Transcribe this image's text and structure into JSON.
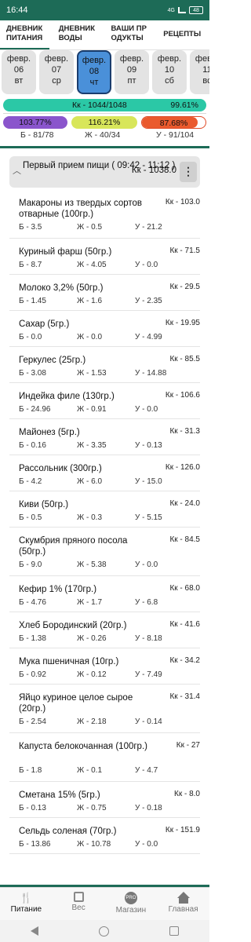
{
  "status": {
    "time": "16:44",
    "network": "4G",
    "battery": "48"
  },
  "tabs": [
    {
      "label": "ДНЕВНИК ПИТАНИЯ"
    },
    {
      "label": "ДНЕВНИК ВОДЫ"
    },
    {
      "label": "ВАШИ ПР ОДУКТЫ"
    },
    {
      "label": "РЕЦЕПТЫ"
    }
  ],
  "days": [
    {
      "month": "февр.",
      "day": "06",
      "dow": "вт"
    },
    {
      "month": "февр.",
      "day": "07",
      "dow": "ср"
    },
    {
      "month": "февр.",
      "day": "08",
      "dow": "чт"
    },
    {
      "month": "февр.",
      "day": "09",
      "dow": "пт"
    },
    {
      "month": "февр.",
      "day": "10",
      "dow": "сб"
    },
    {
      "month": "февр.",
      "day": "11",
      "dow": "вс"
    }
  ],
  "summary": {
    "kcal": "Кк - 1044/1048",
    "kcal_pct": "99.61%",
    "protein_pct": "103.77%",
    "fat_pct": "116.21%",
    "carbs_pct": "87.68%",
    "carbs_fill": 0.8768,
    "protein": "Б - 81/78",
    "fat": "Ж - 40/34",
    "carbs": "У - 91/104"
  },
  "meal": {
    "title": "Первый прием пищи ( 09:42 - 11:12 )",
    "kcal": "Кк - 1038.0",
    "more": "⋮",
    "chevron": "︿"
  },
  "items": [
    {
      "name": "Макароны из твердых сортов отварные (100гр.)",
      "kk": "Кк - 103.0",
      "b": "Б - 3.5",
      "j": "Ж - 0.5",
      "u": "У - 21.2"
    },
    {
      "name": "Куриный фарш (50гр.)",
      "kk": "Кк - 71.5",
      "b": "Б - 8.7",
      "j": "Ж - 4.05",
      "u": "У - 0.0"
    },
    {
      "name": "Молоко 3,2% (50гр.)",
      "kk": "Кк - 29.5",
      "b": "Б - 1.45",
      "j": "Ж - 1.6",
      "u": "У - 2.35"
    },
    {
      "name": "Сахар (5гр.)",
      "kk": "Кк - 19.95",
      "b": "Б - 0.0",
      "j": "Ж - 0.0",
      "u": "У - 4.99"
    },
    {
      "name": "Геркулес (25гр.)",
      "kk": "Кк - 85.5",
      "b": "Б - 3.08",
      "j": "Ж - 1.53",
      "u": "У - 14.88"
    },
    {
      "name": "Индейка филе (130гр.)",
      "kk": "Кк - 106.6",
      "b": "Б - 24.96",
      "j": "Ж - 0.91",
      "u": "У - 0.0"
    },
    {
      "name": "Майонез (5гр.)",
      "kk": "Кк - 31.3",
      "b": "Б - 0.16",
      "j": "Ж - 3.35",
      "u": "У - 0.13"
    },
    {
      "name": "Рассольник (300гр.)",
      "kk": "Кк - 126.0",
      "b": "Б - 4.2",
      "j": "Ж - 6.0",
      "u": "У - 15.0"
    },
    {
      "name": "Киви (50гр.)",
      "kk": "Кк - 24.0",
      "b": "Б - 0.5",
      "j": "Ж - 0.3",
      "u": "У - 5.15"
    },
    {
      "name": "Скумбрия пряного посола (50гр.)",
      "kk": "Кк - 84.5",
      "b": "Б - 9.0",
      "j": "Ж - 5.38",
      "u": "У - 0.0"
    },
    {
      "name": "Кефир 1% (170гр.)",
      "kk": "Кк - 68.0",
      "b": "Б - 4.76",
      "j": "Ж - 1.7",
      "u": "У - 6.8"
    },
    {
      "name": "Хлеб Бородинский (20гр.)",
      "kk": "Кк - 41.6",
      "b": "Б - 1.38",
      "j": "Ж - 0.26",
      "u": "У - 8.18"
    },
    {
      "name": "Мука пшеничная (10гр.)",
      "kk": "Кк - 34.2",
      "b": "Б - 0.92",
      "j": "Ж - 0.12",
      "u": "У - 7.49"
    },
    {
      "name": "Яйцо куриное целое сырое (20гр.)",
      "kk": "Кк - 31.4",
      "b": "Б - 2.54",
      "j": "Ж - 2.18",
      "u": "У - 0.14"
    },
    {
      "name": "Капуста белокочанная (100гр.)",
      "kk": "Кк - 27",
      "b": "Б - 1.8",
      "j": "Ж - 0.1",
      "u": "У - 4.7"
    },
    {
      "name": "Сметана 15% (5гр.)",
      "kk": "Кк - 8.0",
      "b": "Б - 0.13",
      "j": "Ж - 0.75",
      "u": "У - 0.18"
    },
    {
      "name": "Сельдь соленая (70гр.)",
      "kk": "Кк - 151.9",
      "b": "Б - 13.86",
      "j": "Ж - 10.78",
      "u": "У - 0.0"
    }
  ],
  "bottom_nav": [
    {
      "label": "Питание",
      "icon": "fork-knife-icon"
    },
    {
      "label": "Вес",
      "icon": "scale-icon"
    },
    {
      "label": "Магазин",
      "icon": "pro-badge-icon",
      "badge": "PRO"
    },
    {
      "label": "Главная",
      "icon": "home-icon"
    }
  ],
  "colors": {
    "brand": "#1d6b57",
    "kcal_bar": "#2bc8a6",
    "protein": "#8a55cc",
    "fat": "#d8e65a",
    "carbs": "#ea5a2e",
    "selected_day": "#4a90d9"
  }
}
